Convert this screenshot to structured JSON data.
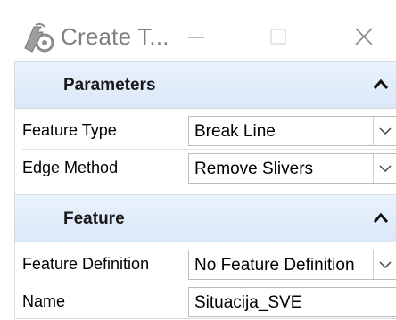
{
  "window": {
    "title": "Create T...",
    "minimize_icon": "minimize-icon",
    "maximize_icon": "maximize-icon",
    "close_icon": "close-icon",
    "app_icon": "civil-tools-icon"
  },
  "panels": {
    "parameters": {
      "title": "Parameters",
      "collapse_icon": "chevron-up-icon",
      "fields": [
        {
          "label": "Feature Type",
          "value": "Break Line"
        },
        {
          "label": "Edge Method",
          "value": "Remove Slivers"
        }
      ]
    },
    "feature": {
      "title": "Feature",
      "collapse_icon": "chevron-up-icon",
      "fields": [
        {
          "label": "Feature Definition",
          "value": "No Feature Definition"
        },
        {
          "label": "Name",
          "value": "Situacija_SVE"
        }
      ]
    }
  },
  "colors": {
    "header_bg": "#dbe8f8",
    "title_text": "#7f7f7f"
  }
}
